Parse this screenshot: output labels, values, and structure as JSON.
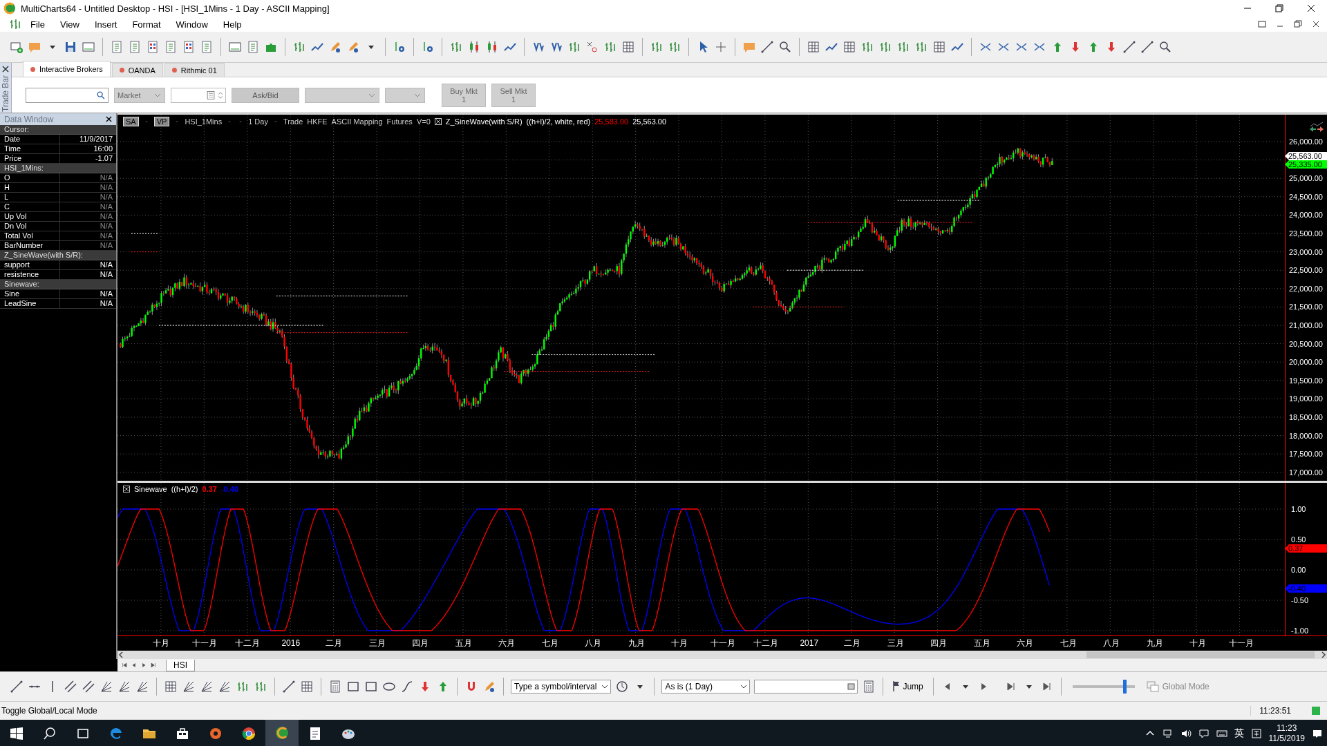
{
  "window": {
    "title": "MultiCharts64 - Untitled Desktop - HSI - [HSI_1Mins - 1 Day - ASCII Mapping]"
  },
  "menu": [
    "File",
    "View",
    "Insert",
    "Format",
    "Window",
    "Help"
  ],
  "trade_bar": {
    "side_label": "Trade Bar",
    "tabs": [
      {
        "label": "Interactive Brokers",
        "selected": true
      },
      {
        "label": "OANDA",
        "selected": false
      },
      {
        "label": "Rithmic 01",
        "selected": false
      }
    ],
    "order_type": "Market",
    "price_button": "Ask/Bid",
    "buy_button": {
      "label": "Buy Mkt",
      "quantity": "1"
    },
    "sell_button": {
      "label": "Sell Mkt",
      "quantity": "1"
    }
  },
  "data_window": {
    "title": "Data Window",
    "sections": [
      {
        "heading": "Cursor:",
        "dimmed": false,
        "rows": [
          {
            "label": "Date",
            "value": "11/9/2017"
          },
          {
            "label": "Time",
            "value": "16:00"
          },
          {
            "label": "Price",
            "value": "-1.07"
          }
        ]
      },
      {
        "heading": "HSI_1Mins:",
        "dimmed": true,
        "rows": [
          {
            "label": "O",
            "value": "N/A"
          },
          {
            "label": "H",
            "value": "N/A"
          },
          {
            "label": "L",
            "value": "N/A"
          },
          {
            "label": "C",
            "value": "N/A"
          },
          {
            "label": "Up Vol",
            "value": "N/A"
          },
          {
            "label": "Dn Vol",
            "value": "N/A"
          },
          {
            "label": "Total Vol",
            "value": "N/A"
          },
          {
            "label": "BarNumber",
            "value": "N/A"
          }
        ]
      },
      {
        "heading": "Z_SineWave(with S/R):",
        "dimmed": false,
        "rows": [
          {
            "label": "support",
            "value": "N/A"
          },
          {
            "label": "resistence",
            "value": "N/A"
          }
        ]
      },
      {
        "heading": "Sinewave:",
        "dimmed": false,
        "rows": [
          {
            "label": "Sine",
            "value": "N/A"
          },
          {
            "label": "LeadSine",
            "value": "N/A"
          }
        ]
      }
    ]
  },
  "chart": {
    "header": {
      "badges": [
        "SA",
        "VP"
      ],
      "symbol": "HSI_1Mins",
      "resolution": "1 Day",
      "details": [
        "Trade",
        "HKFE",
        "ASCII Mapping",
        "Futures",
        "V=0"
      ],
      "study": "Z_SineWave(with S/R)",
      "study_params": "((h+l)/2,  white,  red)",
      "study_values": [
        {
          "text": "25,583.00",
          "color": "#ff0000"
        },
        {
          "text": "25,563.00",
          "color": "#ffffff"
        }
      ]
    },
    "price_axis": [
      "26,000.00",
      "25,000.00",
      "24,500.00",
      "24,000.00",
      "23,500.00",
      "23,000.00",
      "22,500.00",
      "22,000.00",
      "21,500.00",
      "21,000.00",
      "20,500.00",
      "20,000.00",
      "19,500.00",
      "19,000.00",
      "18,500.00",
      "18,000.00",
      "17,500.00",
      "17,000.00"
    ],
    "price_markers": [
      {
        "text": "25,563.00",
        "color": "#ffffff"
      },
      {
        "text": "25,335.00",
        "color": "#00ff00"
      }
    ]
  },
  "indicator": {
    "name": "Sinewave",
    "params": "((h+l)/2)",
    "values": [
      {
        "text": "0.37",
        "color": "#ff0000"
      },
      {
        "text": "-0.40",
        "color": "#0000ff"
      }
    ],
    "axis": [
      "1.00",
      "0.50",
      "0.00",
      "-0.50",
      "-1.00"
    ],
    "markers": [
      {
        "text": "0.37",
        "color": "#ff0000"
      },
      {
        "text": "-0.40",
        "color": "#0000ff"
      }
    ]
  },
  "time_axis": [
    "十月",
    "十一月",
    "十二月",
    "2016",
    "二月",
    "三月",
    "四月",
    "五月",
    "六月",
    "七月",
    "八月",
    "九月",
    "十月",
    "十一月",
    "十二月",
    "2017",
    "二月",
    "三月",
    "四月",
    "五月",
    "六月",
    "七月",
    "八月",
    "九月",
    "十月",
    "十一月"
  ],
  "sheet_tab": "HSI",
  "drawing_bar": {
    "symbol_field": "Type a symbol/interval",
    "resolution": "As is (1 Day)",
    "jump": "Jump",
    "zoom_slider": {
      "level": 0.84
    },
    "global_mode": {
      "label": "Global Mode",
      "disabled": true
    }
  },
  "status_bar": {
    "message": "Toggle Global/Local Mode",
    "time": "11:23:51"
  },
  "taskbar": {
    "apps": [
      {
        "kind": "edge",
        "selected": false
      },
      {
        "kind": "folder",
        "selected": false
      },
      {
        "kind": "store",
        "selected": false
      },
      {
        "kind": "media",
        "selected": false
      },
      {
        "kind": "browser",
        "selected": false
      },
      {
        "kind": "charts",
        "selected": true
      },
      {
        "kind": "editor",
        "selected": false
      },
      {
        "kind": "paint",
        "selected": false
      }
    ],
    "ime": "英",
    "time": "11:23",
    "date": "11/5/2019"
  }
}
